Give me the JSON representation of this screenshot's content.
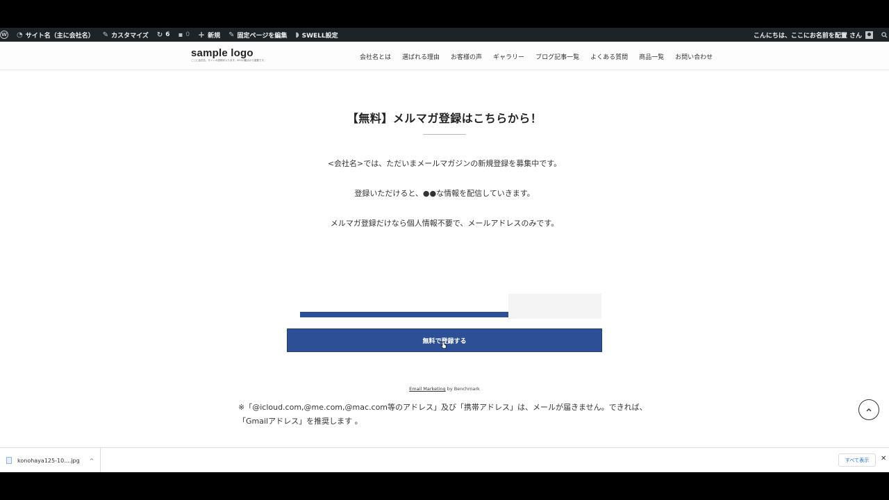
{
  "admin_bar": {
    "wp_logo": "W",
    "site_name": "サイト名（主に会社名）",
    "customize": "カスタマイズ",
    "updates_count": "6",
    "comments_count": "0",
    "new_label": "新規",
    "edit_page": "固定ページを編集",
    "swell_settings": "SWELL設定",
    "greeting": "こんにちは、ここにお名前を配置 さん",
    "icons": [
      "wordpress-icon",
      "dashboard-icon",
      "brush-icon",
      "refresh-icon",
      "comment-icon",
      "plus-icon",
      "pencil-icon",
      "swell-icon",
      "user-icon",
      "search-icon"
    ]
  },
  "header": {
    "logo_text": "sample logo",
    "logo_subtext": "ここに会社名、サイトの説明が入ります。SEOの観点から重要です。",
    "nav": [
      "会社名とは",
      "選ばれる理由",
      "お客様の声",
      "ギャラリー",
      "ブログ記事一覧",
      "よくある質問",
      "商品一覧",
      "お問い合わせ"
    ]
  },
  "main": {
    "title": "【無料】メルマガ登録はこちらから！",
    "lead_lines": [
      "<会社名>では、ただいまメールマガジンの新規登録を募集中です。",
      "登録いただけると、●●な情報を配信していきます。",
      "メルマガ登録だけなら個人情報不要で、メールアドレスのみです。"
    ],
    "submit_label": "無料で登録する",
    "credit_link": "Email Marketing",
    "credit_by": " by Benchmark",
    "note_line1": "※「@icloud.com,@me.com,@mac.com等のアドレス」及び「携帯アドレス」は、メールが届きません。できれば、",
    "note_line2": "「Gmailアドレス」を推奨します 。",
    "page_top_icon": "chevron-up-icon"
  },
  "download_bar": {
    "file_name": "konohaya125-10....jpg",
    "show_all": "すべて表示",
    "close": "✕"
  },
  "colors": {
    "admin_bar_bg": "#1d2327",
    "accent_blue": "#2c4f96"
  }
}
